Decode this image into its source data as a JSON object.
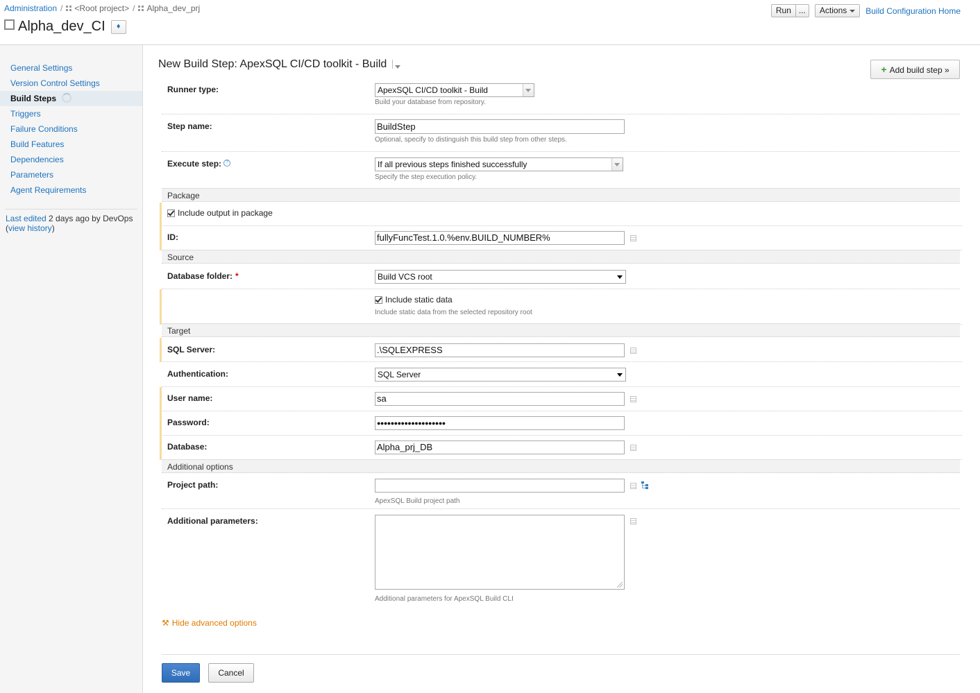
{
  "breadcrumb": {
    "administration": "Administration",
    "root_project": "<Root project>",
    "project": "Alpha_dev_prj",
    "separator": "/"
  },
  "header": {
    "title": "Alpha_dev_CI",
    "run_label": "Run",
    "run_more_label": "...",
    "actions_label": "Actions",
    "home_link": "Build Configuration Home"
  },
  "sidebar": {
    "items": [
      {
        "label": "General Settings"
      },
      {
        "label": "Version Control Settings"
      },
      {
        "label": "Build Steps"
      },
      {
        "label": "Triggers"
      },
      {
        "label": "Failure Conditions"
      },
      {
        "label": "Build Features"
      },
      {
        "label": "Dependencies"
      },
      {
        "label": "Parameters"
      },
      {
        "label": "Agent Requirements"
      }
    ],
    "active_index": 2,
    "last_edited_link": "Last edited",
    "last_edited_text": " 2 days ago by DevOps",
    "view_history_open": "(",
    "view_history": "view history",
    "view_history_close": ")"
  },
  "main": {
    "step_title": "New Build Step: ApexSQL CI/CD toolkit - Build",
    "add_step_label": "Add build step »",
    "runner": {
      "label": "Runner type:",
      "value": "ApexSQL CI/CD toolkit - Build",
      "hint": "Build your database from repository."
    },
    "step_name": {
      "label": "Step name:",
      "value": "BuildStep",
      "hint": "Optional, specify to distinguish this build step from other steps."
    },
    "execute_step": {
      "label": "Execute step:",
      "help": "?",
      "value": "If all previous steps finished successfully",
      "hint": "Specify the step execution policy."
    },
    "sections": {
      "package": "Package",
      "source": "Source",
      "target": "Target",
      "additional": "Additional options"
    },
    "include_output": {
      "label": "Include output in package",
      "checked": true
    },
    "id_field": {
      "label": "ID:",
      "value": "fullyFuncTest.1.0.%env.BUILD_NUMBER%"
    },
    "database_folder": {
      "label": "Database folder:",
      "required": "*",
      "value": "Build VCS root"
    },
    "include_static": {
      "label": "Include static data",
      "checked": true,
      "hint": "Include static data from the selected repository root"
    },
    "sql_server": {
      "label": "SQL Server:",
      "value": ".\\SQLEXPRESS"
    },
    "authentication": {
      "label": "Authentication:",
      "value": "SQL Server"
    },
    "user_name": {
      "label": "User name:",
      "value": "sa"
    },
    "password": {
      "label": "Password:",
      "value": "●●●●●●●●●●●●●●●●●●●●"
    },
    "database": {
      "label": "Database:",
      "value": "Alpha_prj_DB"
    },
    "project_path": {
      "label": "Project path:",
      "value": "",
      "hint": "ApexSQL Build project path"
    },
    "additional_params": {
      "label": "Additional parameters:",
      "value": "",
      "hint": "Additional parameters for ApexSQL Build CLI"
    },
    "hide_advanced": "Hide advanced options",
    "save_label": "Save",
    "cancel_label": "Cancel"
  },
  "colors": {
    "link": "#1e73be",
    "advanced_marker": "#f6dc9e",
    "warning_link": "#e07b00",
    "save_button": "#3a76c2"
  },
  "icons": {
    "status": "status-square-icon",
    "project": "project-grid-icon",
    "bulb": "lightbulb-icon",
    "param": "parameter-list-icon",
    "tree": "vcs-tree-icon",
    "wrench": "wrench-icon"
  }
}
